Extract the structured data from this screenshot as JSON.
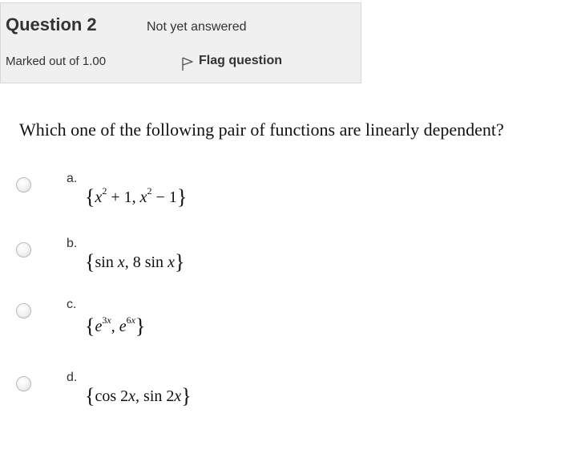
{
  "question_info": {
    "title": "Question",
    "number": "2",
    "state": "Not yet answered",
    "grade": "Marked out of 1.00",
    "flag_label": "Flag question"
  },
  "question_text": "Which one of the following pair of functions are linearly dependent?",
  "answers": [
    {
      "letter": "a.",
      "math_text": "{x² + 1, x² − 1}"
    },
    {
      "letter": "b.",
      "math_text": "{sin x, 8 sin x}"
    },
    {
      "letter": "c.",
      "math_text": "{e³ˣ, e⁶ˣ}"
    },
    {
      "letter": "d.",
      "math_text": "{cos 2x, sin 2x}"
    }
  ],
  "colors": {
    "info_background": "#f0f0f0",
    "info_border": "#d8d8d8",
    "text": "#333333"
  }
}
